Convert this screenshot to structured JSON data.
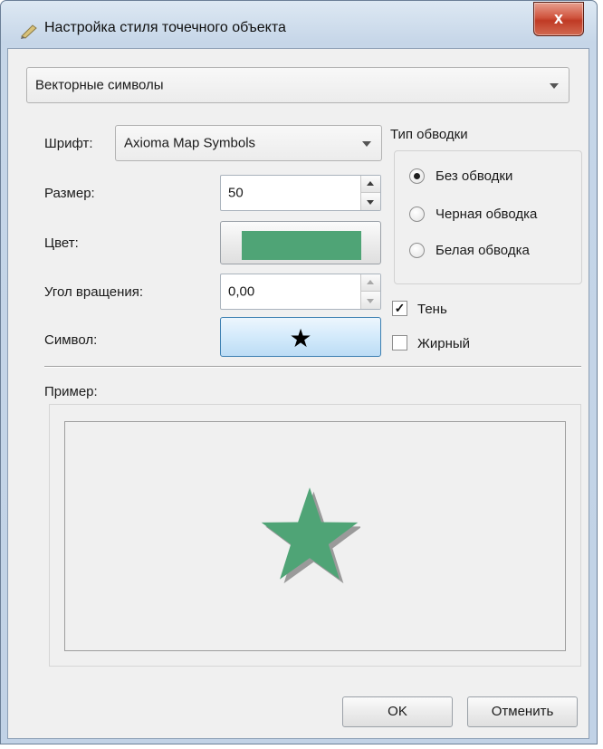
{
  "window": {
    "title": "Настройка стиля точечного объекта",
    "close_label": "x"
  },
  "symbol_type": {
    "selected": "Векторные символы"
  },
  "font": {
    "label": "Шрифт:",
    "value": "Axioma Map Symbols"
  },
  "size": {
    "label": "Размер:",
    "value": "50"
  },
  "color": {
    "label": "Цвет:",
    "swatch_color": "#4fa476"
  },
  "rotation": {
    "label": "Угол вращения:",
    "value": "0,00"
  },
  "symbol": {
    "label": "Символ:",
    "glyph": "★"
  },
  "outline": {
    "title": "Тип обводки",
    "options": [
      {
        "label": "Без обводки",
        "selected": true
      },
      {
        "label": "Черная обводка",
        "selected": false
      },
      {
        "label": "Белая обводка",
        "selected": false
      }
    ]
  },
  "shadow": {
    "label": "Тень",
    "checked": true,
    "mark": "✓"
  },
  "bold": {
    "label": "Жирный",
    "checked": false
  },
  "preview": {
    "label": "Пример:",
    "star_color": "#4fa476",
    "shadow_color": "#9a9a9a"
  },
  "buttons": {
    "ok": "OK",
    "cancel": "Отменить"
  }
}
